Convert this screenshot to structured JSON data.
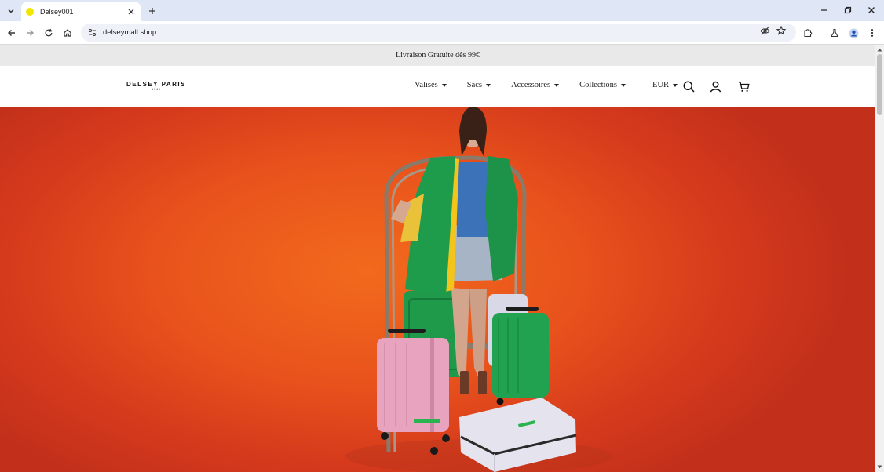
{
  "browser": {
    "tab_title": "Delsey001",
    "url": "delseymall.shop",
    "colors": {
      "tabstrip": "#dfe6f5",
      "favicon": "#f2e600"
    }
  },
  "site": {
    "promo_text": "Livraison Gratuite dès 99€",
    "logo": {
      "main": "DELSEY PARIS",
      "sub": "1946"
    },
    "nav": [
      {
        "label": "Valises",
        "has_dropdown": true
      },
      {
        "label": "Sacs",
        "has_dropdown": true
      },
      {
        "label": "Accessoires",
        "has_dropdown": true
      },
      {
        "label": "Collections",
        "has_dropdown": true
      },
      {
        "label": "EUR",
        "has_dropdown": true
      }
    ],
    "header_icons": [
      "search-icon",
      "account-icon",
      "cart-icon"
    ],
    "hero": {
      "background_color": "#e8521c",
      "image_subject": "model in green coat beside luggage trolley with pink, green and white suitcases"
    }
  }
}
